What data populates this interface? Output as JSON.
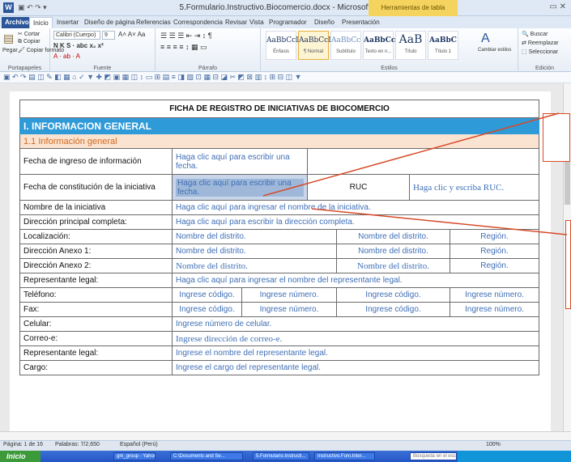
{
  "window": {
    "title": "5.Formulario.Instructivo.Biocomercio.docx - Microsoft Word",
    "context_tab": "Herramientas de tabla"
  },
  "ribbon_tabs": [
    "Archivo",
    "Inicio",
    "Insertar",
    "Diseño de página",
    "Referencias",
    "Correspondencia",
    "Revisar",
    "Vista",
    "Programador",
    "Diseño",
    "Presentación"
  ],
  "clipboard": {
    "paste": "Pegar",
    "cut": "Cortar",
    "copy": "Copiar",
    "format": "Copiar formato",
    "label": "Portapapeles"
  },
  "font": {
    "name": "Calibri (Cuerpo)",
    "size": "9",
    "label": "Fuente"
  },
  "paragraph": {
    "label": "Párrafo"
  },
  "styles": {
    "label": "Estilos",
    "items": [
      {
        "sample": "AaBbCcI",
        "name": "Énfasis"
      },
      {
        "sample": "AaBbCcI",
        "name": "¶ Normal"
      },
      {
        "sample": "AaBbCc",
        "name": "Subtítulo"
      },
      {
        "sample": "AaBbCcl",
        "name": "Texto en n..."
      },
      {
        "sample": "AaB",
        "name": "Título"
      },
      {
        "sample": "AaBbC",
        "name": "Título 1"
      }
    ],
    "change": "Cambiar estilos"
  },
  "editing": {
    "find": "Buscar",
    "replace": "Reemplazar",
    "select": "Seleccionar",
    "label": "Edición"
  },
  "form": {
    "title": "FICHA DE REGISTRO DE INICIATIVAS DE BIOCOMERCIO",
    "section": "I. INFORMACION GENERAL",
    "subsection": "1.1 Información general",
    "rows": {
      "ingreso_lbl": "Fecha de ingreso de información",
      "ingreso_ph": "Haga clic aquí para escribir una fecha.",
      "constitucion_lbl": "Fecha de constitución de la iniciativa",
      "constitucion_ph": "Haga clic aquí para escribir una fecha.",
      "ruc_lbl": "RUC",
      "ruc_ph": "Haga clic y escriba RUC.",
      "nombre_lbl": "Nombre de la iniciativa",
      "nombre_ph": "Haga clic aquí para ingresar el nombre de la iniciativa.",
      "direccion_lbl": "Dirección principal completa:",
      "direccion_ph": "Haga clic aquí para escribir la dirección completa.",
      "localizacion_lbl": "Localización:",
      "anexo1_lbl": "Dirección Anexo 1:",
      "anexo2_lbl": "Dirección Anexo 2:",
      "distrito_ph": "Nombre del distrito.",
      "region_ph": "Región.",
      "representante_lbl": "Representante legal:",
      "representante_ph": "Haga clic aquí para ingresar el nombre del representante legal.",
      "telefono_lbl": "Teléfono:",
      "fax_lbl": "Fax:",
      "codigo_ph": "Ingrese código.",
      "numero_ph": "Ingrese número.",
      "celular_lbl": "Celular:",
      "celular_ph": "Ingrese número de celular.",
      "correo_lbl": "Correo-e:",
      "correo_ph": "Ingrese dirección de correo-e.",
      "representante2_lbl": "Representante legal:",
      "representante2_ph": "Ingrese el nombre del representante legal.",
      "cargo_lbl": "Cargo:",
      "cargo_ph": "Ingrese el cargo del representante legal."
    }
  },
  "status": {
    "page": "Página: 1 de 16",
    "words": "Palabras: 7/2,650",
    "lang": "Español (Perú)",
    "zoom": "100%"
  },
  "taskbar": {
    "start": "Inicio",
    "tasks": [
      "gm_group - Yahoo!...",
      "C:\\Documents and Se...",
      "5.Formulario.Instructi...",
      "Instructivo.Fom.Inter..."
    ],
    "search_placeholder": "Búsqueda en el escritorio"
  }
}
